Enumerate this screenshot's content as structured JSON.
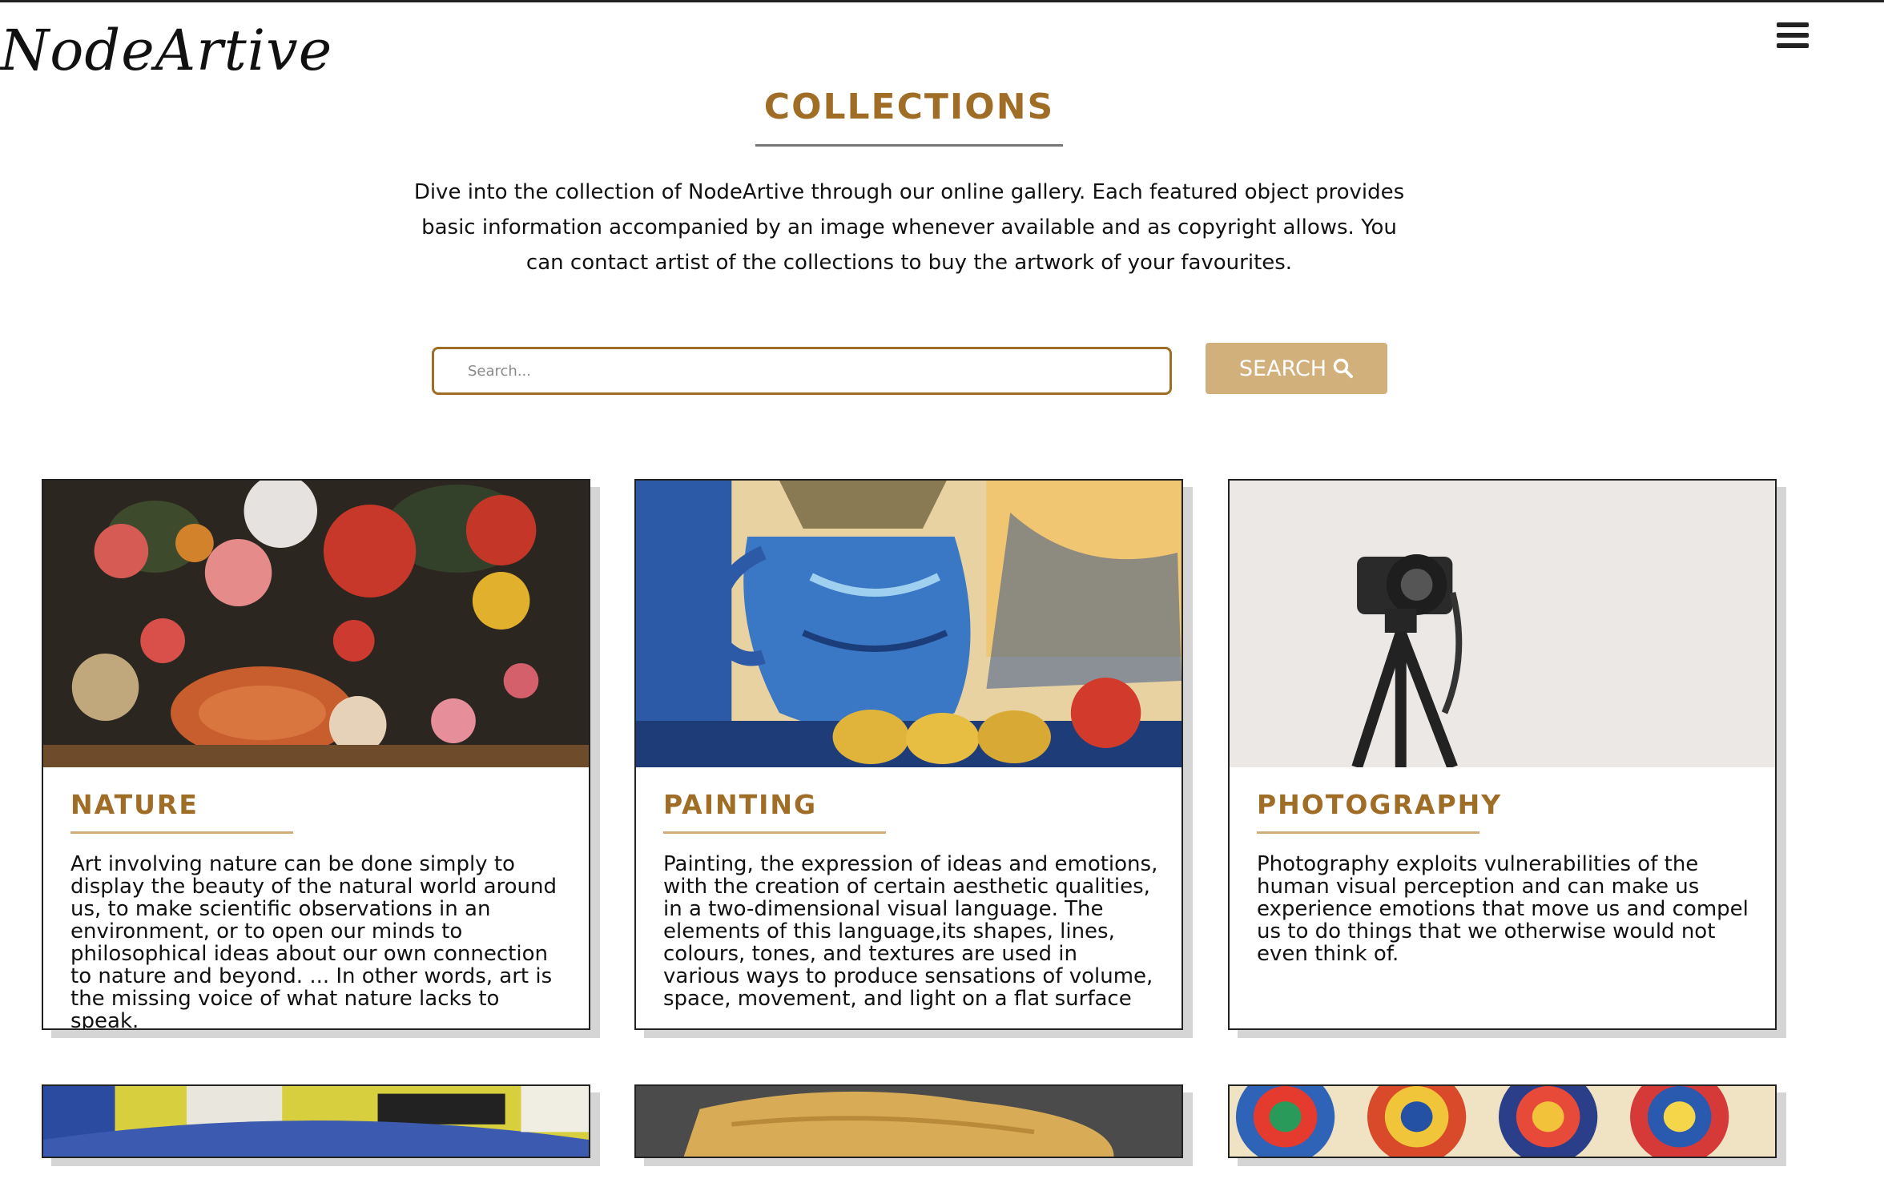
{
  "brand": {
    "logo_text": "NodeArtive"
  },
  "header": {
    "menu_icon": "hamburger-menu-icon"
  },
  "page": {
    "title": "COLLECTIONS",
    "intro": "Dive into the collection of NodeArtive through our online gallery. Each featured object provides basic information accompanied by an image whenever available and as copyright allows. You can contact artist of the collections to buy the artwork of your favourites."
  },
  "search": {
    "placeholder": "Search...",
    "value": "",
    "button_label": "SEARCH",
    "button_icon": "magnifier-icon"
  },
  "colors": {
    "accent": "#a06d26",
    "button": "#d2b07c",
    "border": "#222222"
  },
  "cards": [
    {
      "title": "NATURE",
      "description": "Art involving nature can be done simply to display the beauty of the natural world around us, to make scientific observations in an environment, or to open our minds to philosophical ideas about our own connection to nature and beyond. ... In other words, art is the missing voice of what nature lacks to speak.",
      "image": "floral-still-life-painting"
    },
    {
      "title": "PAINTING",
      "description": "Painting, the expression of ideas and emotions, with the creation of certain aesthetic qualities, in a two-dimensional visual language. The elements of this language,its shapes, lines, colours, tones, and textures are used in various ways to produce sensations of volume, space, movement, and light on a flat surface",
      "image": "blue-pitcher-impasto-painting"
    },
    {
      "title": "PHOTOGRAPHY",
      "description": "Photography exploits vulnerabilities of the human visual perception and can make us experience emotions that move us and compel us to do things that we otherwise would not even think of.",
      "image": "camera-on-tripod-photo"
    }
  ],
  "partial_cards": [
    {
      "image": "abstract-yellow-painting"
    },
    {
      "image": "yellow-sculpture-photo"
    },
    {
      "image": "concentric-circles-painting"
    }
  ]
}
